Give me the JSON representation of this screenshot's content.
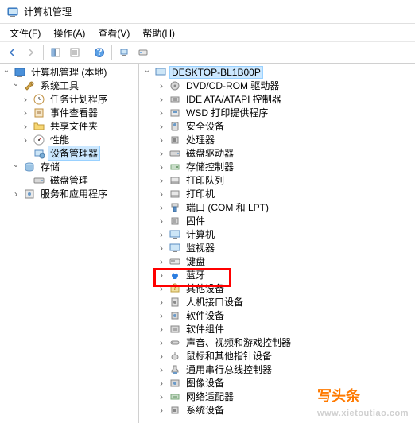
{
  "window": {
    "title": "计算机管理"
  },
  "menu": {
    "file": "文件(F)",
    "action": "操作(A)",
    "view": "查看(V)",
    "help": "帮助(H)"
  },
  "left_tree": {
    "root": "计算机管理 (本地)",
    "system_tools": "系统工具",
    "task_scheduler": "任务计划程序",
    "event_viewer": "事件查看器",
    "shared_folders": "共享文件夹",
    "performance": "性能",
    "device_manager": "设备管理器",
    "storage": "存储",
    "disk_management": "磁盘管理",
    "services_apps": "服务和应用程序"
  },
  "right_tree": {
    "root": "DESKTOP-BL1B00P",
    "items": [
      "DVD/CD-ROM 驱动器",
      "IDE ATA/ATAPI 控制器",
      "WSD 打印提供程序",
      "安全设备",
      "处理器",
      "磁盘驱动器",
      "存储控制器",
      "打印队列",
      "打印机",
      "端口 (COM 和 LPT)",
      "固件",
      "计算机",
      "监视器",
      "键盘",
      "蓝牙",
      "其他设备",
      "人机接口设备",
      "软件设备",
      "软件组件",
      "声音、视频和游戏控制器",
      "鼠标和其他指针设备",
      "通用串行总线控制器",
      "图像设备",
      "网络适配器",
      "系统设备"
    ]
  },
  "watermark": {
    "cn": "写头条",
    "url": "www.xietoutiao.com"
  }
}
